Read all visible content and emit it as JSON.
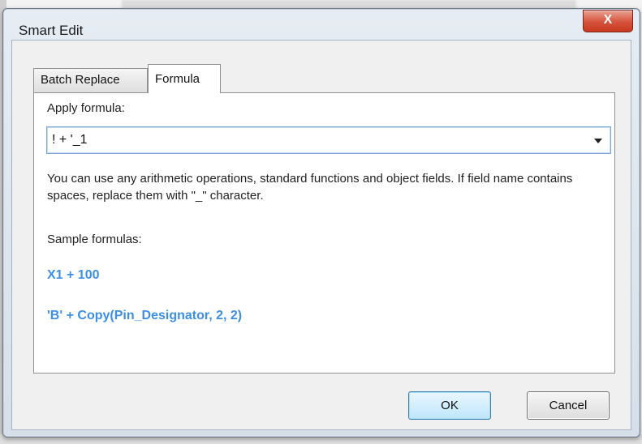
{
  "window": {
    "title": "Smart Edit",
    "close_glyph": "X"
  },
  "tabs": [
    {
      "label": "Batch Replace",
      "selected": false
    },
    {
      "label": "Formula",
      "selected": true
    }
  ],
  "formula_tab": {
    "apply_label": "Apply formula:",
    "formula_value": "! + '_1",
    "help_text": "You can use any arithmetic operations, standard functions and object fields. If field name contains spaces, replace them with \"_\" character.",
    "sample_label": "Sample formulas:",
    "samples": [
      "X1 + 100",
      "'B' + Copy(Pin_Designator, 2, 2)"
    ]
  },
  "buttons": {
    "ok": "OK",
    "cancel": "Cancel"
  },
  "colors": {
    "sample_text": "#3d8fe6",
    "close_button": "#d6523b",
    "focus_border": "#7aa7d6"
  },
  "icons": {
    "close": "close-icon",
    "dropdown": "chevron-down-icon"
  }
}
